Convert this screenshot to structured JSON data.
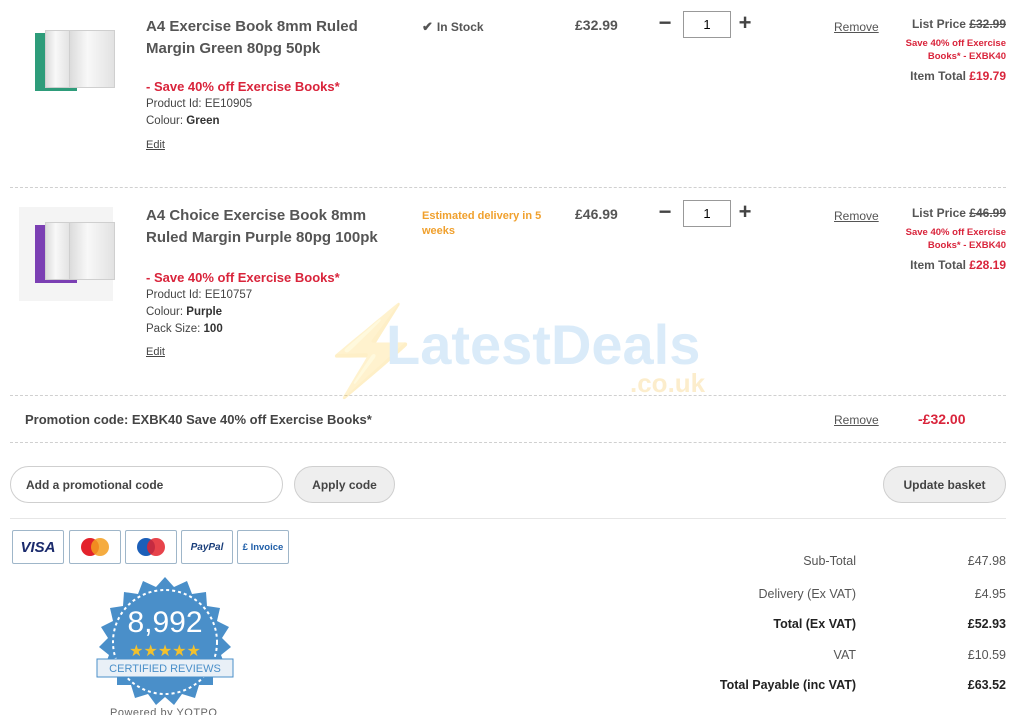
{
  "items": [
    {
      "title": "A4 Exercise Book 8mm Ruled Margin Green 80pg 50pk",
      "promo": "- Save 40% off Exercise Books*",
      "product_id_label": "Product Id: ",
      "product_id": "EE10905",
      "colour_label": "Colour: ",
      "colour": "Green",
      "edit": "Edit",
      "availability": "In Stock",
      "price": "£32.99",
      "quantity": "1",
      "remove": "Remove",
      "list_price_label": "List Price ",
      "list_price": "£32.99",
      "promo_detail": "Save 40% off Exercise Books* - EXBK40",
      "item_total_label": "Item Total ",
      "item_total": "£19.79",
      "cover_color": "#2e9c7a"
    },
    {
      "title": "A4 Choice Exercise Book 8mm Ruled Margin Purple 80pg 100pk",
      "promo": "- Save 40% off Exercise Books*",
      "product_id_label": "Product Id: ",
      "product_id": "EE10757",
      "colour_label": "Colour: ",
      "colour": "Purple",
      "pack_label": "Pack Size: ",
      "pack_size": "100",
      "edit": "Edit",
      "availability": "Estimated delivery in 5 weeks",
      "price": "£46.99",
      "quantity": "1",
      "remove": "Remove",
      "list_price_label": "List Price ",
      "list_price": "£46.99",
      "promo_detail": "Save 40% off Exercise Books* - EXBK40",
      "item_total_label": "Item Total ",
      "item_total": "£28.19",
      "cover_color": "#7b3fb3"
    }
  ],
  "promotion": {
    "text": "Promotion code: EXBK40 Save 40% off Exercise Books*",
    "remove": "Remove",
    "amount": "-£32.00"
  },
  "promo_input": {
    "placeholder": "Add a promotional code"
  },
  "buttons": {
    "apply": "Apply code",
    "update": "Update basket"
  },
  "payment_cards": [
    "VISA",
    "PayPal",
    "£ Invoice"
  ],
  "reviews": {
    "count": "8,992",
    "label": "CERTIFIED REVIEWS",
    "powered_by": "Powered by YOTPO",
    "rating": 4.5
  },
  "summary": [
    {
      "label": "Sub-Total",
      "value": "£47.98",
      "bold": false
    },
    {
      "label": "Delivery (Ex VAT)",
      "value": "£4.95",
      "bold": false
    },
    {
      "label": "Total (Ex VAT)",
      "value": "£52.93",
      "bold": true
    },
    {
      "label": "VAT",
      "value": "£10.59",
      "bold": false
    },
    {
      "label": "Total Payable (inc VAT)",
      "value": "£63.52",
      "bold": true
    }
  ],
  "watermark": {
    "brand": "LatestDeals",
    "domain": ".co.uk"
  },
  "colors": {
    "accent_red": "#d9243b",
    "delivery_orange": "#f0a02d"
  }
}
